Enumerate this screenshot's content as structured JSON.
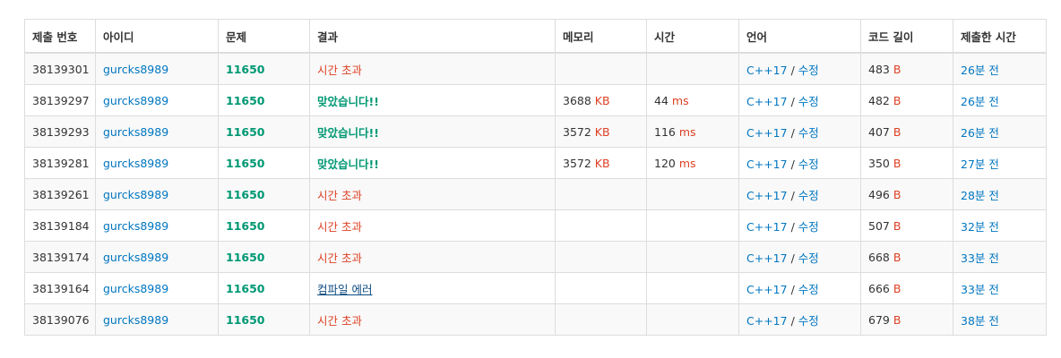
{
  "headers": [
    "제출 번호",
    "아이디",
    "문제",
    "결과",
    "메모리",
    "시간",
    "언어",
    "코드 길이",
    "제출한 시간"
  ],
  "colors": {
    "link": "#0076c0",
    "accepted": "#009874",
    "tle": "#dd4124",
    "compile_error": "#0f4c81",
    "unit": "#dd4124",
    "border": "#dddddd",
    "stripe": "#f9f9f9"
  },
  "rows": [
    {
      "id": "38139301",
      "user": "gurcks8989",
      "problem": "11650",
      "result": "시간 초과",
      "result_kind": "tle",
      "memory": "",
      "memory_unit": "",
      "time": "",
      "time_unit": "",
      "lang": "C++17",
      "sep": " / ",
      "edit": "수정",
      "code_len": "483",
      "code_unit": "B",
      "submitted": "26분 전"
    },
    {
      "id": "38139297",
      "user": "gurcks8989",
      "problem": "11650",
      "result": "맞았습니다!!",
      "result_kind": "ac",
      "memory": "3688",
      "memory_unit": "KB",
      "time": "44",
      "time_unit": "ms",
      "lang": "C++17",
      "sep": " / ",
      "edit": "수정",
      "code_len": "482",
      "code_unit": "B",
      "submitted": "26분 전"
    },
    {
      "id": "38139293",
      "user": "gurcks8989",
      "problem": "11650",
      "result": "맞았습니다!!",
      "result_kind": "ac",
      "memory": "3572",
      "memory_unit": "KB",
      "time": "116",
      "time_unit": "ms",
      "lang": "C++17",
      "sep": " / ",
      "edit": "수정",
      "code_len": "407",
      "code_unit": "B",
      "submitted": "26분 전"
    },
    {
      "id": "38139281",
      "user": "gurcks8989",
      "problem": "11650",
      "result": "맞았습니다!!",
      "result_kind": "ac",
      "memory": "3572",
      "memory_unit": "KB",
      "time": "120",
      "time_unit": "ms",
      "lang": "C++17",
      "sep": " / ",
      "edit": "수정",
      "code_len": "350",
      "code_unit": "B",
      "submitted": "27분 전"
    },
    {
      "id": "38139261",
      "user": "gurcks8989",
      "problem": "11650",
      "result": "시간 초과",
      "result_kind": "tle",
      "memory": "",
      "memory_unit": "",
      "time": "",
      "time_unit": "",
      "lang": "C++17",
      "sep": " / ",
      "edit": "수정",
      "code_len": "496",
      "code_unit": "B",
      "submitted": "28분 전"
    },
    {
      "id": "38139184",
      "user": "gurcks8989",
      "problem": "11650",
      "result": "시간 초과",
      "result_kind": "tle",
      "memory": "",
      "memory_unit": "",
      "time": "",
      "time_unit": "",
      "lang": "C++17",
      "sep": " / ",
      "edit": "수정",
      "code_len": "507",
      "code_unit": "B",
      "submitted": "32분 전"
    },
    {
      "id": "38139174",
      "user": "gurcks8989",
      "problem": "11650",
      "result": "시간 초과",
      "result_kind": "tle",
      "memory": "",
      "memory_unit": "",
      "time": "",
      "time_unit": "",
      "lang": "C++17",
      "sep": " / ",
      "edit": "수정",
      "code_len": "668",
      "code_unit": "B",
      "submitted": "33분 전"
    },
    {
      "id": "38139164",
      "user": "gurcks8989",
      "problem": "11650",
      "result": "컴파일 에러",
      "result_kind": "ce",
      "memory": "",
      "memory_unit": "",
      "time": "",
      "time_unit": "",
      "lang": "C++17",
      "sep": " / ",
      "edit": "수정",
      "code_len": "666",
      "code_unit": "B",
      "submitted": "33분 전"
    },
    {
      "id": "38139076",
      "user": "gurcks8989",
      "problem": "11650",
      "result": "시간 초과",
      "result_kind": "tle",
      "memory": "",
      "memory_unit": "",
      "time": "",
      "time_unit": "",
      "lang": "C++17",
      "sep": " / ",
      "edit": "수정",
      "code_len": "679",
      "code_unit": "B",
      "submitted": "38분 전"
    }
  ]
}
